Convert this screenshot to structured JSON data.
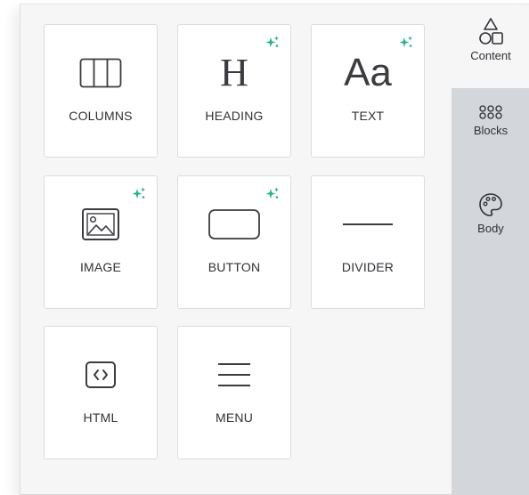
{
  "tiles": [
    {
      "label": "COLUMNS",
      "icon": "columns-icon",
      "ai": false
    },
    {
      "label": "HEADING",
      "icon": "heading-icon",
      "ai": true
    },
    {
      "label": "TEXT",
      "icon": "text-icon",
      "ai": true
    },
    {
      "label": "IMAGE",
      "icon": "image-icon",
      "ai": true
    },
    {
      "label": "BUTTON",
      "icon": "button-icon",
      "ai": true
    },
    {
      "label": "DIVIDER",
      "icon": "divider-icon",
      "ai": false
    },
    {
      "label": "HTML",
      "icon": "html-icon",
      "ai": false
    },
    {
      "label": "MENU",
      "icon": "menu-icon",
      "ai": false
    }
  ],
  "icon_glyphs": {
    "heading": "H",
    "text": "Aa"
  },
  "sidebar": {
    "tabs": [
      {
        "label": "Content",
        "icon": "shapes-icon",
        "active": true
      },
      {
        "label": "Blocks",
        "icon": "blocks-icon",
        "active": false
      },
      {
        "label": "Body",
        "icon": "palette-icon",
        "active": false
      }
    ]
  },
  "colors": {
    "sparkle": "#1fb48f",
    "icon": "#3a3c40",
    "sidebar_bg": "#d3d6da"
  }
}
